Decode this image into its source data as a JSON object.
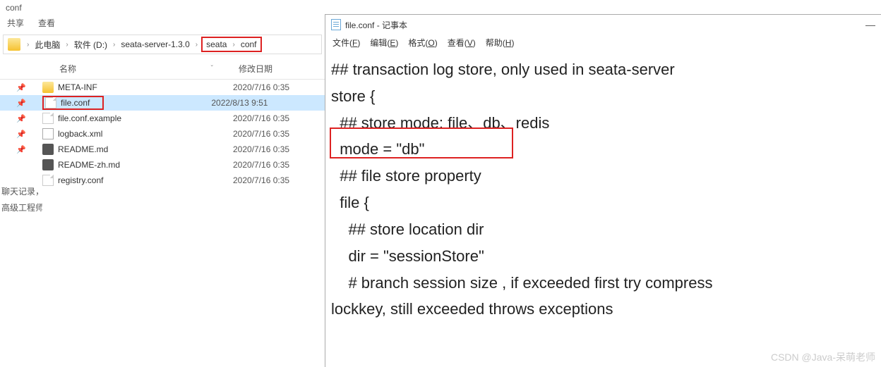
{
  "explorer": {
    "title": "conf",
    "tabs": [
      "共享",
      "查看"
    ],
    "breadcrumb": [
      "此电脑",
      "软件 (D:)",
      "seata-server-1.3.0",
      "seata",
      "conf"
    ],
    "columns": {
      "name": "名称",
      "date": "修改日期"
    },
    "files": [
      {
        "name": "META-INF",
        "date": "2020/7/16 0:35",
        "type": "folder",
        "pin": true
      },
      {
        "name": "file.conf",
        "date": "2022/8/13 9:51",
        "type": "doc",
        "pin": true,
        "selected": true,
        "highlight": true
      },
      {
        "name": "file.conf.example",
        "date": "2020/7/16 0:35",
        "type": "doc",
        "pin": true
      },
      {
        "name": "logback.xml",
        "date": "2020/7/16 0:35",
        "type": "xml",
        "pin": true
      },
      {
        "name": "README.md",
        "date": "2020/7/16 0:35",
        "type": "md",
        "pin": true
      },
      {
        "name": "README-zh.md",
        "date": "2020/7/16 0:35",
        "type": "md"
      },
      {
        "name": "registry.conf",
        "date": "2020/7/16 0:35",
        "type": "doc"
      }
    ],
    "sidebar": [
      "聊天记录，↓",
      "高级工程师"
    ]
  },
  "notepad": {
    "title": "file.conf - 记事本",
    "menu": [
      {
        "label": "文件",
        "key": "F"
      },
      {
        "label": "编辑",
        "key": "E"
      },
      {
        "label": "格式",
        "key": "O"
      },
      {
        "label": "查看",
        "key": "V"
      },
      {
        "label": "帮助",
        "key": "H"
      }
    ],
    "lines": [
      "## transaction log store, only used in seata-server",
      "store {",
      "  ## store mode: file、db、redis",
      "  mode = \"db\"",
      "",
      "  ## file store property",
      "  file {",
      "    ## store location dir",
      "    dir = \"sessionStore\"",
      "    # branch session size , if exceeded first try compress",
      "lockkey, still exceeded throws exceptions"
    ]
  },
  "watermark": "CSDN @Java-呆萌老师"
}
